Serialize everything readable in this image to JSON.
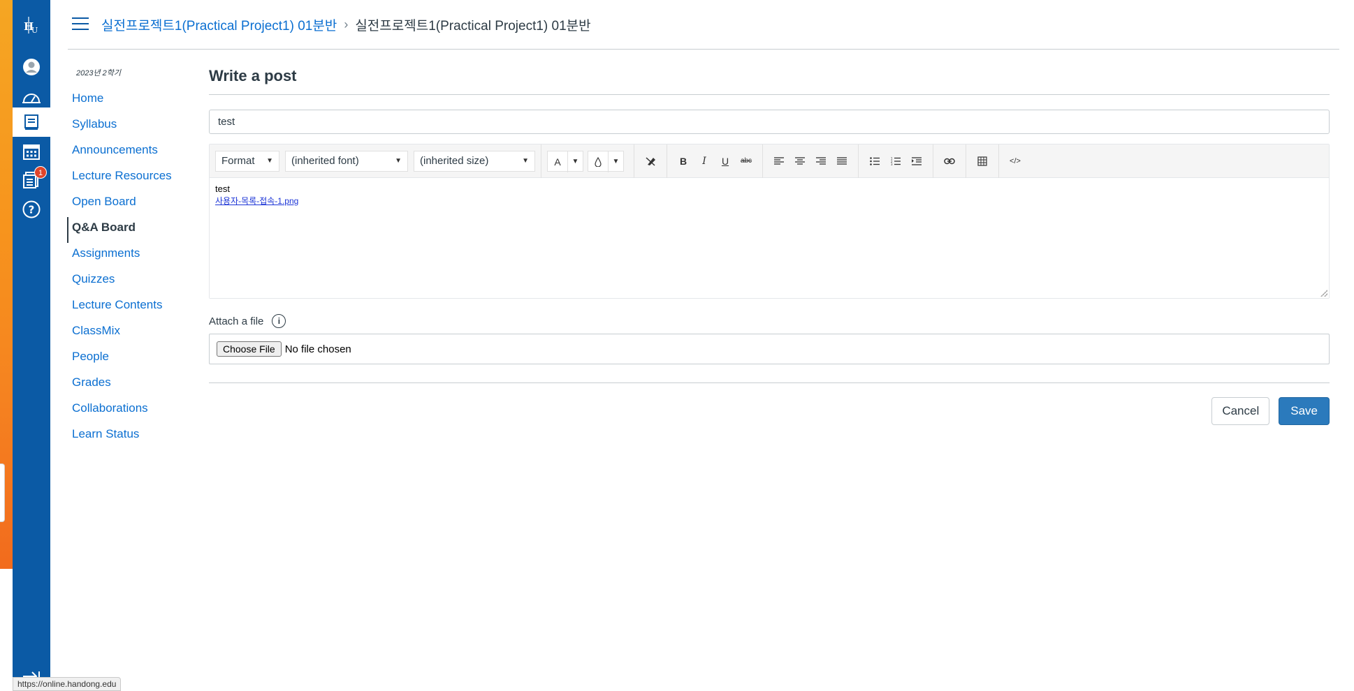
{
  "breadcrumb": {
    "course_link": "실전프로젝트1(Practical Project1) 01분반",
    "separator": "›",
    "current": "실전프로젝트1(Practical Project1) 01분반"
  },
  "global_nav": {
    "logo": "HGU",
    "items": [
      "account-icon",
      "dashboard-icon",
      "courses-icon",
      "calendar-icon",
      "inbox-icon",
      "help-icon"
    ],
    "inbox_badge": "1"
  },
  "course_nav": {
    "term": "2023년 2학기",
    "items": [
      {
        "label": "Home",
        "active": false
      },
      {
        "label": "Syllabus",
        "active": false
      },
      {
        "label": "Announcements",
        "active": false
      },
      {
        "label": "Lecture Resources",
        "active": false
      },
      {
        "label": "Open Board",
        "active": false
      },
      {
        "label": "Q&A Board",
        "active": true
      },
      {
        "label": "Assignments",
        "active": false
      },
      {
        "label": "Quizzes",
        "active": false
      },
      {
        "label": "Lecture Contents",
        "active": false
      },
      {
        "label": "ClassMix",
        "active": false
      },
      {
        "label": "People",
        "active": false
      },
      {
        "label": "Grades",
        "active": false
      },
      {
        "label": "Collaborations",
        "active": false
      },
      {
        "label": "Learn Status",
        "active": false
      }
    ]
  },
  "form": {
    "title": "Write a post",
    "title_value": "test",
    "toolbar": {
      "format": "Format",
      "font": "(inherited font)",
      "size": "(inherited size)"
    },
    "body_text": "test",
    "body_link": "사용자-목록-접속-1.png",
    "attach_label": "Attach a file",
    "choose_file": "Choose File",
    "no_file": "No file chosen",
    "cancel": "Cancel",
    "save": "Save"
  },
  "status_url": "https://online.handong.edu",
  "colors": {
    "nav_blue": "#0b5aa5",
    "link_blue": "#0b6fd1",
    "save_blue": "#2b7abc",
    "badge_red": "#e0452b"
  }
}
